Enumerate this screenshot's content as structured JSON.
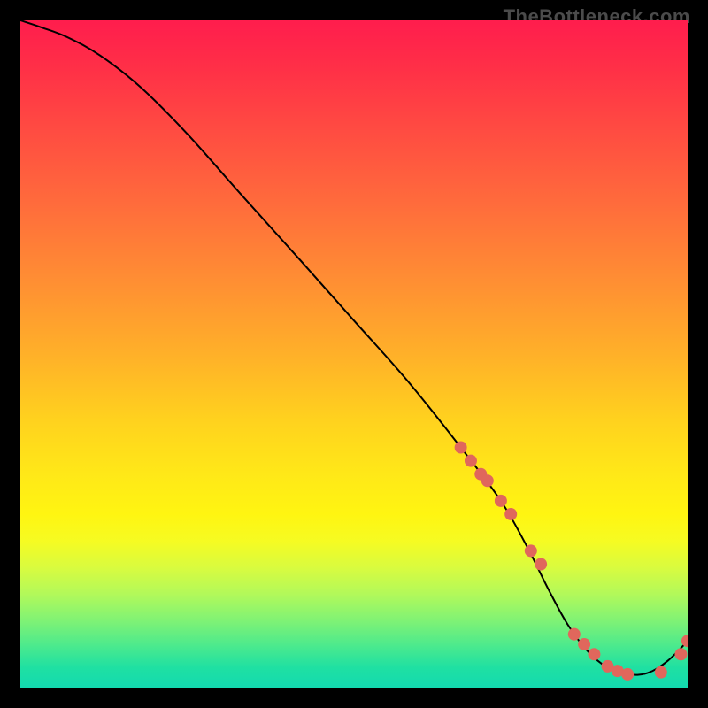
{
  "watermark": "TheBottleneck.com",
  "chart_data": {
    "type": "line",
    "title": "",
    "xlabel": "",
    "ylabel": "",
    "xlim": [
      0,
      100
    ],
    "ylim": [
      0,
      100
    ],
    "grid": false,
    "legend": false,
    "series": [
      {
        "name": "curve",
        "color": "#000000",
        "x": [
          0,
          3,
          7,
          12,
          18,
          25,
          33,
          42,
          50,
          58,
          66,
          72,
          76,
          79,
          82,
          85,
          88,
          91,
          94,
          97,
          100
        ],
        "y": [
          100,
          99,
          97.5,
          94.7,
          90,
          83,
          74,
          64,
          55,
          46,
          36,
          28,
          21,
          15,
          9.5,
          5.5,
          3,
          2,
          2.2,
          4,
          7
        ]
      }
    ],
    "markers": [
      {
        "name": "points",
        "color": "#e0675c",
        "radius_px": 7,
        "x": [
          66,
          67.5,
          69,
          70,
          72,
          73.5,
          76.5,
          78,
          83,
          84.5,
          86,
          88,
          89.5,
          91,
          96,
          99,
          100
        ],
        "y": [
          36,
          34,
          32,
          31,
          28,
          26,
          20.5,
          18.5,
          8,
          6.5,
          5,
          3.2,
          2.5,
          2,
          2.3,
          5,
          7
        ]
      }
    ]
  }
}
